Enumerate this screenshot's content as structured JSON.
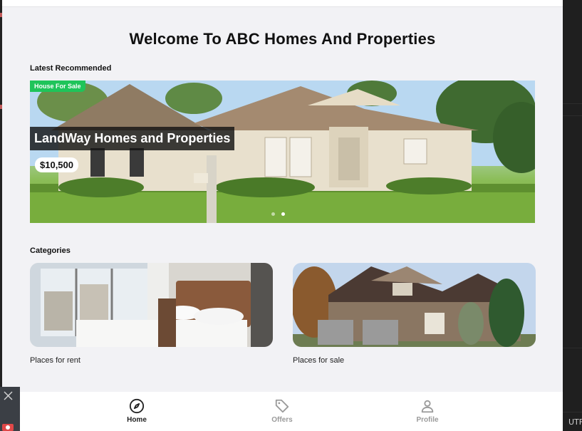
{
  "page": {
    "title": "Welcome To ABC Homes And Properties"
  },
  "recommended": {
    "heading": "Latest Recommended",
    "badge": "House For Sale",
    "slide_title": "LandWay Homes and Properties",
    "price": "$10,500",
    "slide_count": 2,
    "active_slide": 2
  },
  "categories": {
    "heading": "Categories",
    "items": [
      {
        "label": "Places for rent",
        "image": "bedroom-photo"
      },
      {
        "label": "Places for sale",
        "image": "stone-house-photo"
      }
    ]
  },
  "nav": {
    "items": [
      {
        "label": "Home",
        "icon": "compass-icon",
        "active": true
      },
      {
        "label": "Offers",
        "icon": "tag-icon",
        "active": false
      },
      {
        "label": "Profile",
        "icon": "user-icon",
        "active": false
      }
    ]
  },
  "editor": {
    "encoding": "UTF"
  },
  "colors": {
    "badge": "#1fc45a",
    "background": "#f2f2f5",
    "active_nav": "#222222",
    "inactive_nav": "#9a9a9a"
  }
}
